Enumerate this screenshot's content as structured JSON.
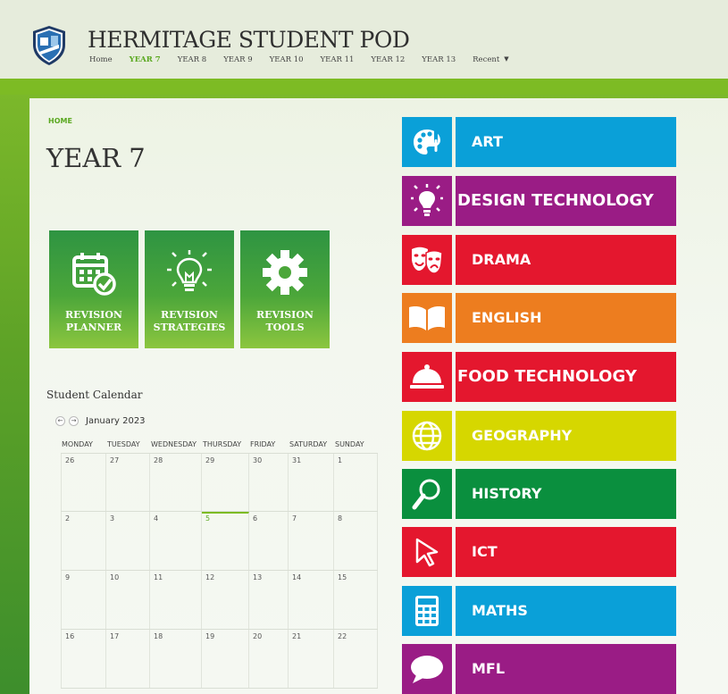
{
  "header": {
    "title": "HERMITAGE STUDENT POD",
    "nav": [
      {
        "label": "Home",
        "active": false
      },
      {
        "label": "YEAR 7",
        "active": true
      },
      {
        "label": "YEAR 8",
        "active": false
      },
      {
        "label": "YEAR 9",
        "active": false
      },
      {
        "label": "YEAR 10",
        "active": false
      },
      {
        "label": "YEAR 11",
        "active": false
      },
      {
        "label": "YEAR 12",
        "active": false
      },
      {
        "label": "YEAR 13",
        "active": false
      },
      {
        "label": "Recent",
        "active": false
      }
    ]
  },
  "breadcrumb": "HOME",
  "page_title": "YEAR 7",
  "tiles": [
    {
      "label": "REVISION\nPLANNER",
      "icon": "calendar-check-icon"
    },
    {
      "label": "REVISION\nSTRATEGIES",
      "icon": "lightbulb-icon"
    },
    {
      "label": "REVISION\nTOOLS",
      "icon": "gear-icon"
    }
  ],
  "calendar": {
    "title": "Student Calendar",
    "month": "January 2023",
    "days": [
      "MONDAY",
      "TUESDAY",
      "WEDNESDAY",
      "THURSDAY",
      "FRIDAY",
      "SATURDAY",
      "SUNDAY"
    ],
    "weeks": [
      [
        "26",
        "27",
        "28",
        "29",
        "30",
        "31",
        "1"
      ],
      [
        "2",
        "3",
        "4",
        "5",
        "6",
        "7",
        "8"
      ],
      [
        "9",
        "10",
        "11",
        "12",
        "13",
        "14",
        "15"
      ],
      [
        "16",
        "17",
        "18",
        "19",
        "20",
        "21",
        "22"
      ]
    ],
    "today": "5"
  },
  "subjects": [
    {
      "label": "ART",
      "color": "#0aa0d8",
      "icon": "palette-icon"
    },
    {
      "label": "DESIGN TECHNOLOGY",
      "color": "#9a1c85",
      "icon": "lightbulb-icon"
    },
    {
      "label": "DRAMA",
      "color": "#e4172e",
      "icon": "theatre-masks-icon"
    },
    {
      "label": "ENGLISH",
      "color": "#ed7d1f",
      "icon": "open-book-icon"
    },
    {
      "label": "FOOD TECHNOLOGY",
      "color": "#e4172e",
      "icon": "cloche-icon"
    },
    {
      "label": "GEOGRAPHY",
      "color": "#d6d700",
      "icon": "globe-icon"
    },
    {
      "label": "HISTORY",
      "color": "#0a8f3e",
      "icon": "magnifier-icon"
    },
    {
      "label": "ICT",
      "color": "#e4172e",
      "icon": "cursor-icon"
    },
    {
      "label": "MATHS",
      "color": "#0aa0d8",
      "icon": "calculator-icon"
    },
    {
      "label": "MFL",
      "color": "#9a1c85",
      "icon": "speech-bubble-icon"
    }
  ]
}
